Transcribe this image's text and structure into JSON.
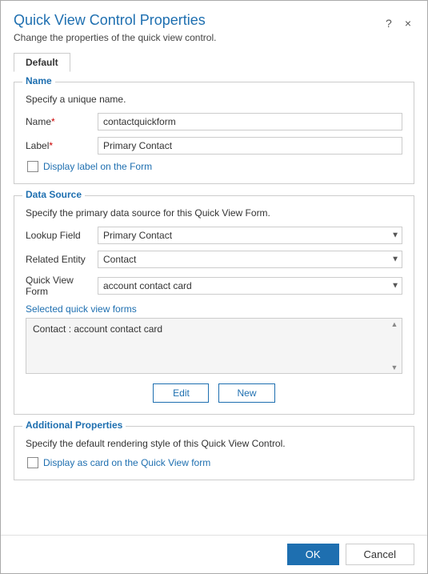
{
  "dialog": {
    "title": "Quick View Control Properties",
    "subtitle": "Change the properties of the quick view control.",
    "help_icon": "?",
    "close_icon": "×"
  },
  "tabs": [
    {
      "label": "Default",
      "active": true
    }
  ],
  "name_section": {
    "legend": "Name",
    "description": "Specify a unique name.",
    "name_label": "Name",
    "name_required": "*",
    "name_value": "contactquickform",
    "label_label": "Label",
    "label_required": "*",
    "label_value": "Primary Contact",
    "checkbox_label": "Display label on the Form"
  },
  "data_source_section": {
    "legend": "Data Source",
    "description": "Specify the primary data source for this Quick View Form.",
    "lookup_field_label": "Lookup Field",
    "lookup_field_value": "Primary Contact",
    "lookup_field_options": [
      "Primary Contact"
    ],
    "related_entity_label": "Related Entity",
    "related_entity_value": "Contact",
    "related_entity_options": [
      "Contact"
    ],
    "quick_view_form_label": "Quick View Form",
    "quick_view_form_value": "account contact card",
    "quick_view_form_options": [
      "account contact card"
    ],
    "selected_forms_label": "Selected quick view forms",
    "selected_forms_value": "Contact : account contact card",
    "edit_button": "Edit",
    "new_button": "New"
  },
  "additional_section": {
    "legend": "Additional Properties",
    "description": "Specify the default rendering style of this Quick View Control.",
    "checkbox_label": "Display as card on the Quick View form"
  },
  "footer": {
    "ok_button": "OK",
    "cancel_button": "Cancel"
  }
}
